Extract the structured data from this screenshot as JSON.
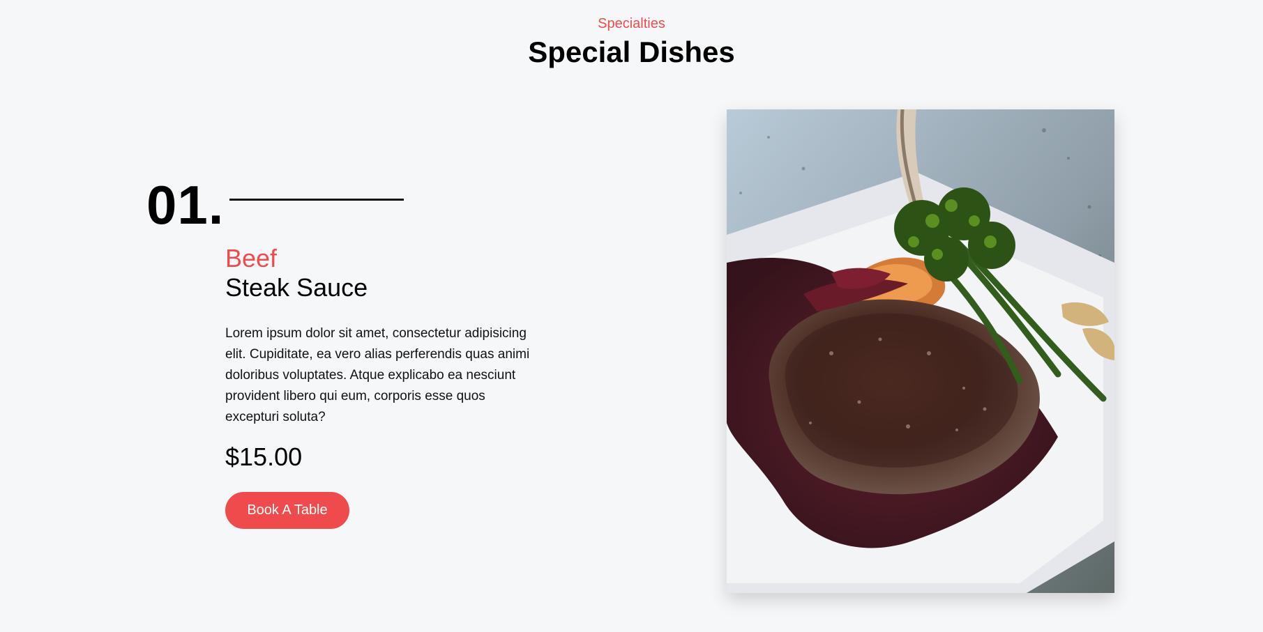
{
  "header": {
    "kicker": "Specialties",
    "title": "Special Dishes"
  },
  "dish": {
    "number": "01.",
    "category": "Beef",
    "name": "Steak Sauce",
    "description": "Lorem ipsum dolor sit amet, consectetur adipisicing elit. Cupiditate, ea vero alias perferendis quas animi doloribus voluptates. Atque explicabo ea nesciunt provident libero qui eum, corporis esse quos excepturi soluta?",
    "price": "$15.00",
    "cta_label": "Book A Table",
    "image_subject": "steak-with-sauce-and-broccolini"
  },
  "colors": {
    "accent": "#f04b4c",
    "background": "#f6f7f9",
    "text": "#111111"
  }
}
